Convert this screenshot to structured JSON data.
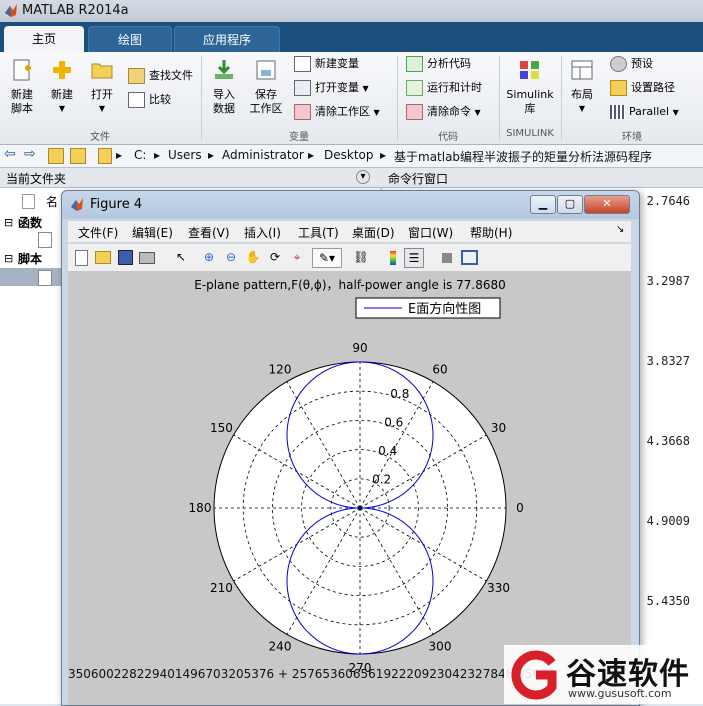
{
  "window": {
    "title": "MATLAB R2014a"
  },
  "ribbon_tabs": [
    {
      "label": "主页",
      "active": true
    },
    {
      "label": "绘图",
      "active": false
    },
    {
      "label": "应用程序",
      "active": false
    }
  ],
  "ribbon": {
    "new_script": "新建\n脚本",
    "new": "新建",
    "open": "打开",
    "find_files": "查找文件",
    "compare": "比较",
    "group_file": "文件",
    "import_data": "导入\n数据",
    "save_workspace": "保存\n工作区",
    "new_variable": "新建变量",
    "open_variable": "打开变量",
    "clear_workspace": "清除工作区",
    "group_variable": "变量",
    "analyze_code": "分析代码",
    "run_and_time": "运行和计时",
    "clear_commands": "清除命令",
    "group_code": "代码",
    "simulink_library": "Simulink\n库",
    "group_simulink": "SIMULINK",
    "layout": "布局",
    "preferences": "预设",
    "set_path": "设置路径",
    "parallel": "Parallel",
    "group_environment": "环境"
  },
  "address": {
    "segments": [
      "C:",
      "Users",
      "Administrator",
      "Desktop",
      "基于matlab编程半波振子的矩量分析法源码程序"
    ]
  },
  "panels": {
    "current_folder": "当前文件夹",
    "command_window": "命令行窗口",
    "name_col": "名",
    "functions": "函数",
    "scripts": "脚本"
  },
  "command_values": [
    "2.7646",
    "3.2987",
    "3.8327",
    "4.3668",
    "4.9009",
    "5.4350"
  ],
  "figure": {
    "title": "Figure 4",
    "menu": [
      "文件(F)",
      "编辑(E)",
      "查看(V)",
      "插入(I)",
      "工具(T)",
      "桌面(D)",
      "窗口(W)",
      "帮助(H)"
    ],
    "status_text": "3506002282294014967032053​76 + 25765360656192220923042327​8465/5076"
  },
  "chart_data": {
    "type": "polar",
    "title": "E-plane pattern,F(θ,ϕ)，half-power angle is 77.8680",
    "series": [
      {
        "name": "E面方向性图",
        "color": "#0000cc",
        "pattern": "|sin(theta)|",
        "max": 1.0
      }
    ],
    "angle_ticks": [
      0,
      30,
      60,
      90,
      120,
      150,
      180,
      210,
      240,
      270,
      300,
      330
    ],
    "radial_ticks": [
      0.2,
      0.4,
      0.6,
      0.8
    ],
    "rlim": [
      0,
      1
    ],
    "grid": true,
    "legend_position": "top-right"
  },
  "watermark": {
    "brand": "谷速软件",
    "url": "www.gususoft.com"
  }
}
